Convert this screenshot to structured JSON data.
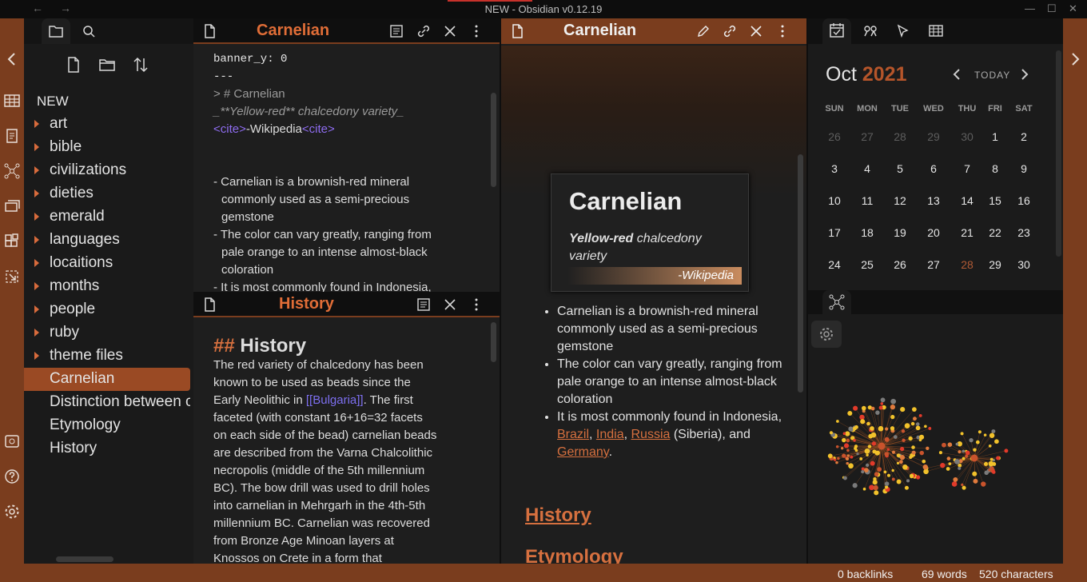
{
  "window": {
    "title": "NEW - Obsidian v0.12.19"
  },
  "file_explorer": {
    "vault_name": "NEW",
    "folders": [
      "art",
      "bible",
      "civilizations",
      "dieties",
      "emerald",
      "languages",
      "locaitions",
      "months",
      "people",
      "ruby",
      "theme files"
    ],
    "files": [
      "Carnelian",
      "Distinction between c",
      "Etymology",
      "History"
    ],
    "active_file": "Carnelian"
  },
  "source_pane": {
    "title": "Carnelian",
    "frontmatter": [
      "banner_y: 0",
      "---"
    ],
    "heading_line": "> # Carnelian",
    "subtitle_line": "_**Yellow-red** chalcedony variety_",
    "cite_open": "<cite>",
    "cite_text": "-Wikipedia",
    "cite_close": "<cite>",
    "bullets": [
      [
        "- Carnelian is a brownish-red mineral",
        "commonly used as a semi-precious",
        "gemstone"
      ],
      [
        "- The color can vary greatly, ranging from",
        "pale orange to an intense almost-black",
        "coloration"
      ],
      [
        "- It is most commonly found in Indonesia,"
      ]
    ]
  },
  "history_pane": {
    "title": "History",
    "heading_marker": "##",
    "heading": "History",
    "lines": [
      "The red variety of chalcedony has been",
      "known to be used as beads since the",
      "Early Neolithic in ",
      "faceted (with constant 16+16=32 facets",
      "on each side of the bead) carnelian beads",
      "are described from the Varna Chalcolithic",
      "necropolis (middle of the 5th millennium",
      "BC). The bow drill was used to drill holes",
      "into carnelian in Mehrgarh in the 4th-5th",
      "millennium BC. Carnelian was recovered",
      "from Bronze Age Minoan layers at",
      "Knossos on Crete in a form that"
    ],
    "link_text": "[[Bulgaria]]",
    "after_link": ". The first"
  },
  "preview_pane": {
    "title": "Carnelian",
    "card_title": "Carnelian",
    "card_subtitle_bold": "Yellow-red",
    "card_subtitle_rest": " chalcedony variety",
    "card_cite": "-Wikipedia",
    "bullets": [
      "Carnelian is a brownish-red mineral commonly used as a semi-precious gemstone",
      "The color can vary greatly, ranging from pale orange to an intense almost-black coloration"
    ],
    "bullet3_prefix": "It is most commonly found in Indonesia, ",
    "bullet3_links": [
      "Brazil",
      "India",
      "Russia"
    ],
    "bullet3_mid": " (Siberia), and ",
    "bullet3_last_link": "Germany",
    "bullet3_end": ".",
    "heading_history": "History",
    "heading_etymology": "Etymology"
  },
  "calendar": {
    "month": "Oct",
    "year": "2021",
    "today_label": "TODAY",
    "weekdays": [
      "SUN",
      "MON",
      "TUE",
      "WED",
      "THU",
      "FRI",
      "SAT"
    ],
    "weeks": [
      [
        "26",
        "27",
        "28",
        "29",
        "30",
        "1",
        "2"
      ],
      [
        "3",
        "4",
        "5",
        "6",
        "7",
        "8",
        "9"
      ],
      [
        "10",
        "11",
        "12",
        "13",
        "14",
        "15",
        "16"
      ],
      [
        "17",
        "18",
        "19",
        "20",
        "21",
        "22",
        "23"
      ],
      [
        "24",
        "25",
        "26",
        "27",
        "28",
        "29",
        "30"
      ]
    ],
    "highlighted_day": "28"
  },
  "status": {
    "backlinks": "0 backlinks",
    "words": "69 words",
    "characters": "520 characters"
  },
  "colors": {
    "accent": "#7a3d1e",
    "title_orange": "#e06d37",
    "link": "#d6703f"
  },
  "icons": [
    "back-arrow-icon",
    "forward-arrow-icon",
    "folder-icon",
    "search-icon",
    "new-file-icon",
    "new-folder-icon",
    "sort-icon",
    "file-icon",
    "edit-icon",
    "link-icon",
    "close-icon",
    "more-icon",
    "calendar-icon",
    "graph-icon",
    "cursor-icon",
    "table-icon",
    "gear-icon",
    "help-icon",
    "settings-icon"
  ]
}
